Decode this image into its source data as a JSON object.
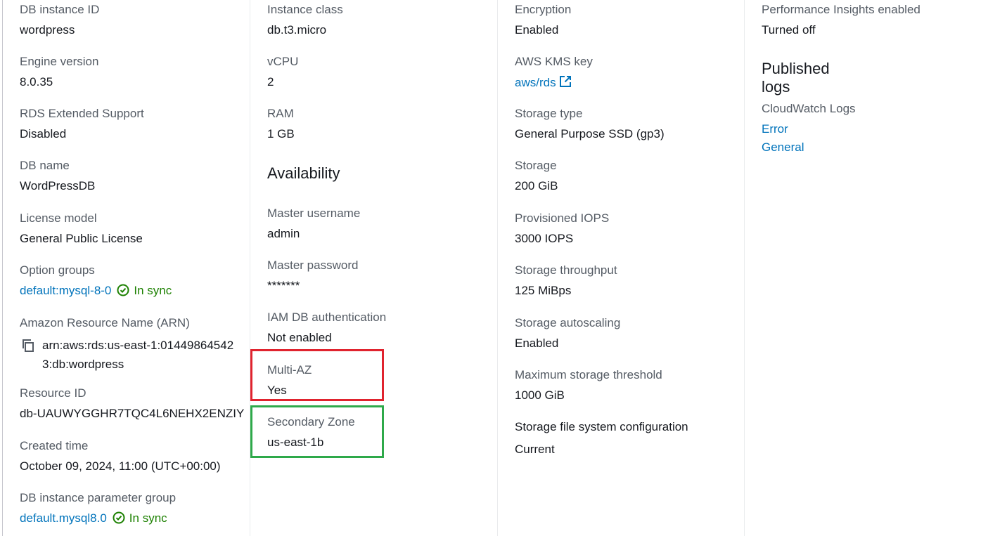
{
  "col1": {
    "db_instance_id": {
      "label": "DB instance ID",
      "value": "wordpress"
    },
    "engine_version": {
      "label": "Engine version",
      "value": "8.0.35"
    },
    "extended_support": {
      "label": "RDS Extended Support",
      "value": "Disabled"
    },
    "db_name": {
      "label": "DB name",
      "value": "WordPressDB"
    },
    "license_model": {
      "label": "License model",
      "value": "General Public License"
    },
    "option_groups": {
      "label": "Option groups",
      "value": "default:mysql-8-0",
      "status": "In sync"
    },
    "arn": {
      "label": "Amazon Resource Name (ARN)",
      "value": "arn:aws:rds:us-east-1:014498645423:db:wordpress"
    },
    "resource_id": {
      "label": "Resource ID",
      "value": "db-UAUWYGGHR7TQC4L6NEHX2ENZIY"
    },
    "created_time": {
      "label": "Created time",
      "value": "October 09, 2024, 11:00 (UTC+00:00)"
    },
    "param_group": {
      "label": "DB instance parameter group",
      "value": "default.mysql8.0",
      "status": "In sync"
    }
  },
  "col2": {
    "instance_class": {
      "label": "Instance class",
      "value": "db.t3.micro"
    },
    "vcpu": {
      "label": "vCPU",
      "value": "2"
    },
    "ram": {
      "label": "RAM",
      "value": "1 GB"
    },
    "availability_heading": "Availability",
    "master_username": {
      "label": "Master username",
      "value": "admin"
    },
    "master_password": {
      "label": "Master password",
      "value": "*******"
    },
    "iam_auth": {
      "label": "IAM DB authentication",
      "value": "Not enabled"
    },
    "multi_az": {
      "label": "Multi-AZ",
      "value": "Yes"
    },
    "secondary_zone": {
      "label": "Secondary Zone",
      "value": "us-east-1b"
    }
  },
  "col3": {
    "encryption": {
      "label": "Encryption",
      "value": "Enabled"
    },
    "kms_key": {
      "label": "AWS KMS key",
      "value": "aws/rds"
    },
    "storage_type": {
      "label": "Storage type",
      "value": "General Purpose SSD (gp3)"
    },
    "storage": {
      "label": "Storage",
      "value": "200 GiB"
    },
    "iops": {
      "label": "Provisioned IOPS",
      "value": "3000 IOPS"
    },
    "throughput": {
      "label": "Storage throughput",
      "value": "125 MiBps"
    },
    "autoscaling": {
      "label": "Storage autoscaling",
      "value": "Enabled"
    },
    "max_threshold": {
      "label": "Maximum storage threshold",
      "value": "1000 GiB"
    },
    "fs_config": {
      "label": "Storage file system configuration",
      "value": "Current"
    }
  },
  "col4": {
    "perf_insights": {
      "label": "Performance Insights enabled",
      "value": "Turned off"
    },
    "published_logs_heading": "Published logs",
    "cloudwatch": {
      "label": "CloudWatch Logs",
      "links": [
        "Error",
        "General"
      ]
    }
  },
  "colors": {
    "link": "#0073bb",
    "success": "#1d8102",
    "highlight_red": "#e0232e",
    "highlight_green": "#2ea94a"
  }
}
